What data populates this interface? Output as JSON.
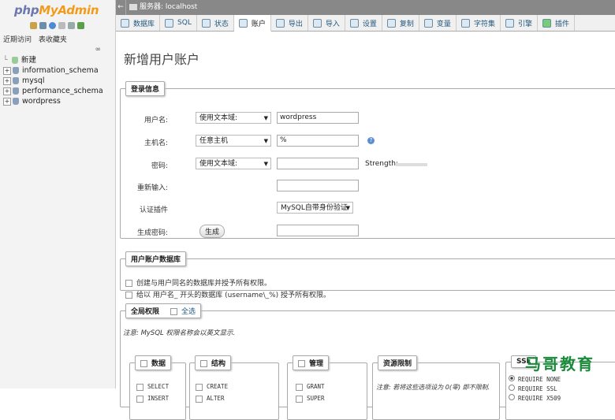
{
  "brand": {
    "name_part1": "php",
    "name_part2": "MyAdmin"
  },
  "nav_links": [
    "近期访问",
    "表收藏夹"
  ],
  "tree": {
    "new": "新建",
    "databases": [
      "information_schema",
      "mysql",
      "performance_schema",
      "wordpress"
    ]
  },
  "topbar": {
    "server": "服务器: localhost"
  },
  "tabs": [
    "数据库",
    "SQL",
    "状态",
    "账户",
    "导出",
    "导入",
    "设置",
    "复制",
    "变量",
    "字符集",
    "引擎",
    "插件"
  ],
  "active_tab": "账户",
  "page": {
    "title": "新增用户账户"
  },
  "login": {
    "legend": "登录信息",
    "username_label": "用户名:",
    "username_type": "使用文本域:",
    "username_value": "wordpress",
    "host_label": "主机名:",
    "host_type": "任意主机",
    "host_value": "%",
    "password_label": "密码:",
    "password_type": "使用文本域:",
    "strength_label": "Strength:",
    "reenter_label": "重新输入:",
    "auth_label": "认证插件",
    "auth_value": "MySQL自带身份验证",
    "generate_label": "生成密码:",
    "generate_button": "生成"
  },
  "userdb": {
    "legend": "用户账户数据库",
    "opt1": "创建与用户同名的数据库并授予所有权限。",
    "opt2": "给以 用户名_ 开头的数据库 (username\\_%) 授予所有权限。"
  },
  "global": {
    "legend": "全局权限",
    "select_all": "全选",
    "note": "注意: MySQL 权限名称会以英文显示.",
    "data_legend": "数据",
    "data_privs": [
      "SELECT",
      "INSERT"
    ],
    "struct_legend": "结构",
    "struct_privs": [
      "CREATE",
      "ALTER"
    ],
    "admin_legend": "管理",
    "admin_privs": [
      "GRANT",
      "SUPER"
    ],
    "limit_legend": "资源限制",
    "limit_note": "注意: 若将这些选项设为 0(零) 即不限制.",
    "ssl_legend": "SSL",
    "ssl_opts": [
      "REQUIRE NONE",
      "REQUIRE SSL",
      "REQUIRE X509"
    ]
  },
  "watermark": "马哥教育"
}
